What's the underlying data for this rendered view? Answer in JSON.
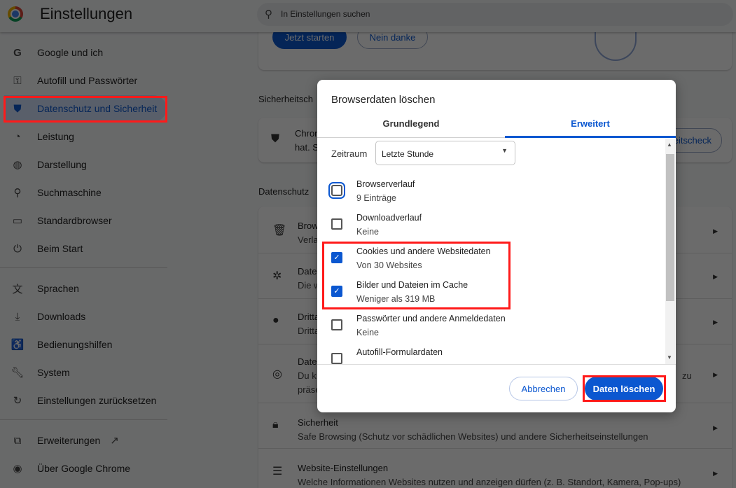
{
  "header": {
    "title": "Einstellungen",
    "search_placeholder": "In Einstellungen suchen"
  },
  "sidebar": {
    "items": [
      {
        "label": "Google und ich",
        "icon": "google-icon"
      },
      {
        "label": "Autofill und Passwörter",
        "icon": "key-icon"
      },
      {
        "label": "Datenschutz und Sicherheit",
        "icon": "shield-icon",
        "selected": true
      },
      {
        "label": "Leistung",
        "icon": "gauge-icon"
      },
      {
        "label": "Darstellung",
        "icon": "palette-icon"
      },
      {
        "label": "Suchmaschine",
        "icon": "search-icon"
      },
      {
        "label": "Standardbrowser",
        "icon": "browser-icon"
      },
      {
        "label": "Beim Start",
        "icon": "power-icon"
      },
      {
        "label": "Sprachen",
        "icon": "translate-icon"
      },
      {
        "label": "Downloads",
        "icon": "download-icon"
      },
      {
        "label": "Bedienungshilfen",
        "icon": "accessibility-icon"
      },
      {
        "label": "System",
        "icon": "wrench-icon"
      },
      {
        "label": "Einstellungen zurücksetzen",
        "icon": "reset-icon"
      },
      {
        "label": "Erweiterungen",
        "icon": "extension-icon"
      },
      {
        "label": "Über Google Chrome",
        "icon": "chrome-icon"
      }
    ]
  },
  "main": {
    "promo": {
      "start_label": "Jetzt starten",
      "decline_label": "Nein danke"
    },
    "safety_heading": "Sicherheitsch",
    "safety_card": {
      "line1": "Chron",
      "line2": "hat. S",
      "button": "eitscheck"
    },
    "privacy_heading": "Datenschutz",
    "rows": [
      {
        "t1": "Brow",
        "t2": "Verla"
      },
      {
        "t1": "Date",
        "t2": "Die w"
      },
      {
        "t1": "Dritta",
        "t2": "Dritta"
      },
      {
        "t1": "Date",
        "t2": "Du k",
        "t3": "präse",
        "tail": "zu"
      },
      {
        "t1": "Sicherheit",
        "t2": "Safe Browsing (Schutz vor schädlichen Websites) und andere Sicherheitseinstellungen"
      },
      {
        "t1": "Website-Einstellungen",
        "t2": "Welche Informationen Websites nutzen und anzeigen dürfen (z. B. Standort, Kamera, Pop-ups)"
      }
    ]
  },
  "dialog": {
    "title": "Browserdaten löschen",
    "tabs": [
      "Grundlegend",
      "Erweitert"
    ],
    "active_tab": "Erweitert",
    "time_range_label": "Zeitraum",
    "time_range_value": "Letzte Stunde",
    "items": [
      {
        "title": "Browserverlauf",
        "detail": "9 Einträge",
        "checked": false
      },
      {
        "title": "Downloadverlauf",
        "detail": "Keine",
        "checked": false
      },
      {
        "title": "Cookies und andere Websitedaten",
        "detail": "Von 30 Websites",
        "checked": true
      },
      {
        "title": "Bilder und Dateien im Cache",
        "detail": "Weniger als 319 MB",
        "checked": true
      },
      {
        "title": "Passwörter und andere Anmeldedaten",
        "detail": "Keine",
        "checked": false
      },
      {
        "title": "Autofill-Formulardaten",
        "detail": "",
        "checked": false
      }
    ],
    "cancel_label": "Abbrechen",
    "confirm_label": "Daten löschen"
  },
  "colors": {
    "accent": "#0b57d0",
    "highlight": "#ff1a1a"
  }
}
